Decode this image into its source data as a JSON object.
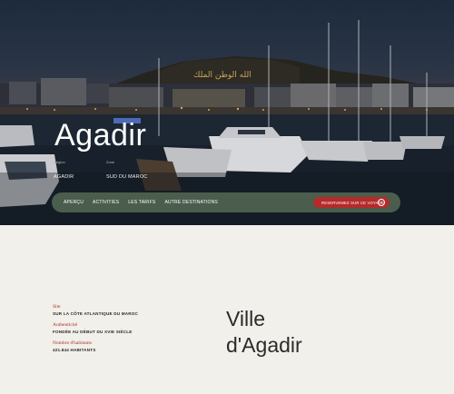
{
  "hero": {
    "title": "Agadir",
    "region_caption": "Région",
    "region_value": "AGADIR",
    "zone_caption": "Zone",
    "zone_value": "SUD DU MAROC",
    "hillside_inscription": "الله الوطن الملك"
  },
  "nav": {
    "items": [
      "APERÇU",
      "ACTIVITIES",
      "LES TARIFS",
      "AUTRE DESTINATIONS"
    ],
    "cta_label": "RESERVEMEZ SUR CE VOYAGE",
    "cta_icon": "arrow-circle-icon"
  },
  "info": [
    {
      "label": "Site",
      "value": "SUR LA CÔTE ATLANTIQUE DU MAROC"
    },
    {
      "label": "Authenticité",
      "value": "FONDÉE AU DÉBUT DU XVIE SIÈCLE"
    },
    {
      "label": "Nombre d'habitants",
      "value": "421.844 HABITANTS"
    }
  ],
  "main": {
    "title_line1": "Ville",
    "title_line2": "d'Agadir"
  },
  "colors": {
    "accent_red": "#b42b2a",
    "nav_green": "#4b5e4d",
    "page_bg": "#f1f0ea"
  }
}
